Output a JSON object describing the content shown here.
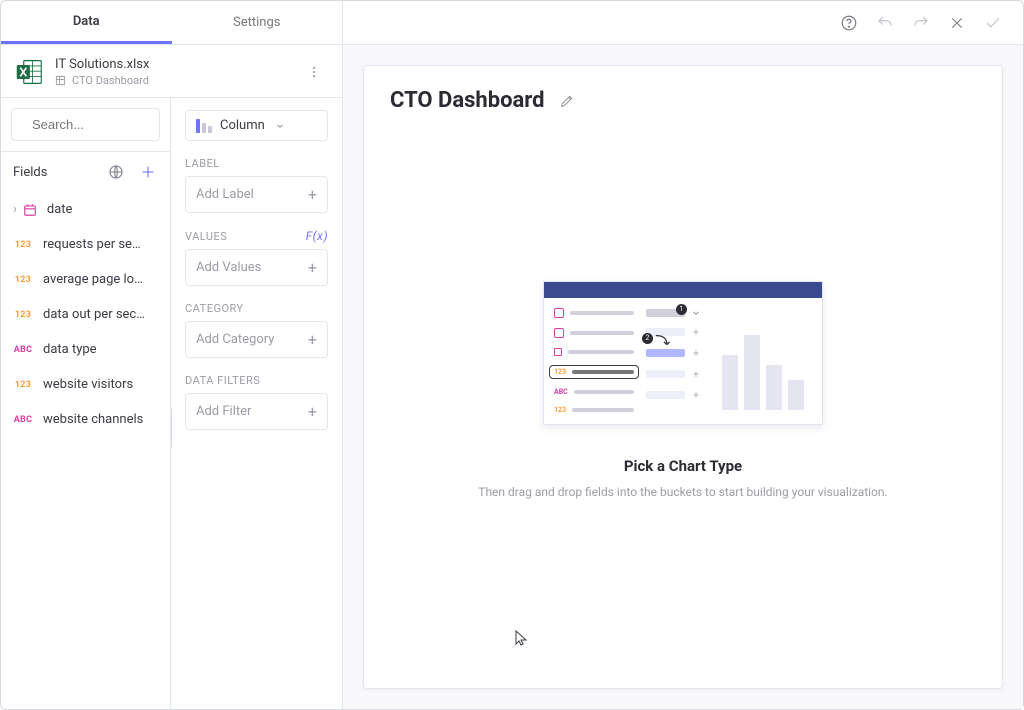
{
  "tabs": {
    "data": "Data",
    "settings": "Settings"
  },
  "file": {
    "name": "IT Solutions.xlsx",
    "sheet": "CTO Dashboard"
  },
  "search": {
    "placeholder": "Search..."
  },
  "fieldsHeader": "Fields",
  "chartType": "Column",
  "buckets": {
    "label": {
      "title": "LABEL",
      "placeholder": "Add Label"
    },
    "values": {
      "title": "VALUES",
      "placeholder": "Add Values",
      "fx": "F(x)"
    },
    "category": {
      "title": "CATEGORY",
      "placeholder": "Add Category"
    },
    "filters": {
      "title": "DATA FILTERS",
      "placeholder": "Add Filter"
    }
  },
  "fields": [
    {
      "type": "date",
      "label": "date"
    },
    {
      "type": "num",
      "label": "requests per se…"
    },
    {
      "type": "num",
      "label": "average page lo…"
    },
    {
      "type": "num",
      "label": "data out per sec…"
    },
    {
      "type": "abc",
      "label": "data type"
    },
    {
      "type": "num",
      "label": "website visitors"
    },
    {
      "type": "abc",
      "label": "website channels"
    }
  ],
  "dashboard": {
    "title": "CTO Dashboard"
  },
  "emptyState": {
    "title": "Pick a Chart Type",
    "subtitle": "Then drag and drop fields into the buckets to start building your visualization."
  },
  "badges": {
    "num": "123",
    "abc": "ABC"
  }
}
